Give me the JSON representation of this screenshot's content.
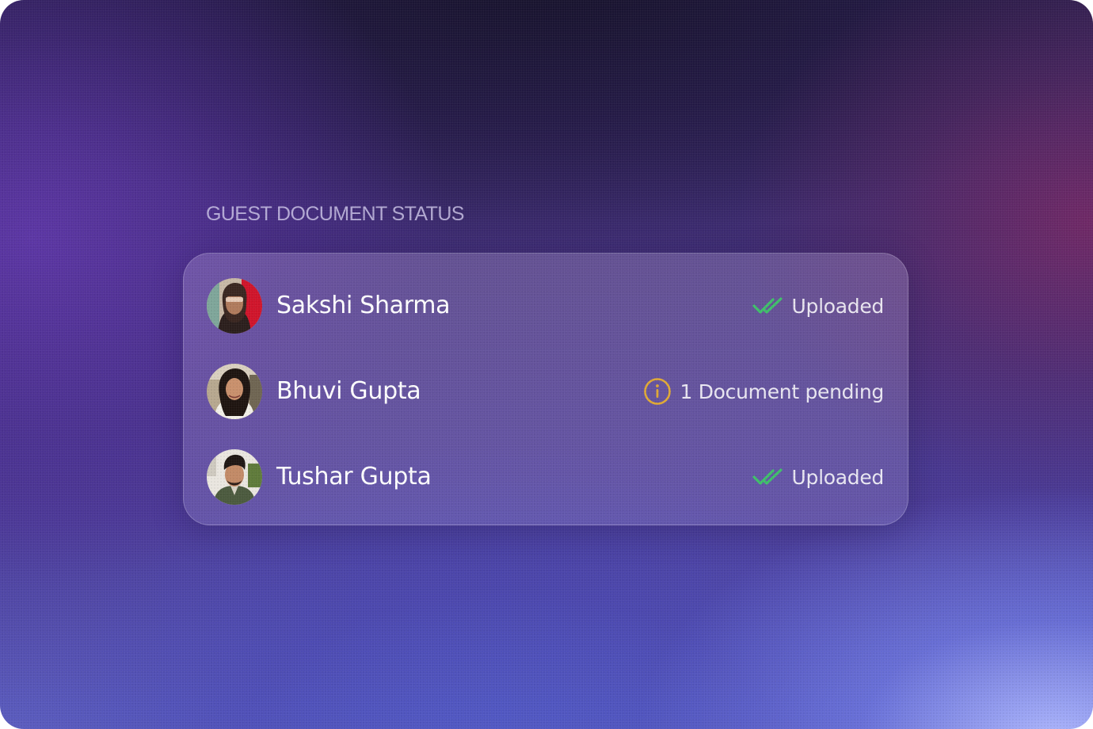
{
  "section": {
    "title": "GUEST DOCUMENT STATUS"
  },
  "colors": {
    "uploaded_check": "#3fbf6a",
    "pending_info": "#e0a935"
  },
  "guests": [
    {
      "name": "Sakshi Sharma",
      "avatar": "avatar-photo",
      "status": "Uploaded",
      "status_icon": "double-check-icon"
    },
    {
      "name": "Bhuvi Gupta",
      "avatar": "avatar-photo",
      "status": "1 Document pending",
      "status_icon": "info-circle-icon"
    },
    {
      "name": "Tushar Gupta",
      "avatar": "avatar-photo",
      "status": "Uploaded",
      "status_icon": "double-check-icon"
    }
  ]
}
